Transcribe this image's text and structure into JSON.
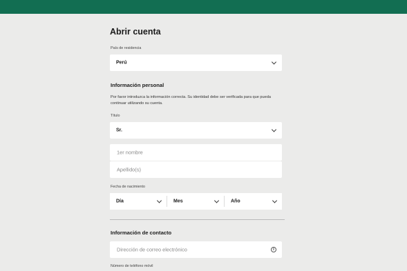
{
  "form": {
    "title": "Abrir cuenta",
    "country": {
      "label": "País de residencia",
      "value": "Perú"
    },
    "personal": {
      "heading": "Información personal",
      "description": "Por favor introduzca la información correcta. Su identidad debe ser verificada para que pueda continuar utilizando su cuenta.",
      "title_label": "Título",
      "title_value": "Sr.",
      "first_name_placeholder": "1er nombre",
      "surname_placeholder": "Apellido(s)",
      "dob_label": "Fecha de nacimiento",
      "dob_day": "Día",
      "dob_month": "Mes",
      "dob_year": "Año"
    },
    "contact": {
      "heading": "Información de contacto",
      "email_placeholder": "Dirección de correo electrónico",
      "info_glyph": "i",
      "phone_label": "Número de teléfono móvil"
    }
  },
  "colors": {
    "header": "#126e52",
    "background": "#ebebea"
  },
  "icons": {
    "dropdown": "chevron-down-icon",
    "info": "info-icon"
  }
}
